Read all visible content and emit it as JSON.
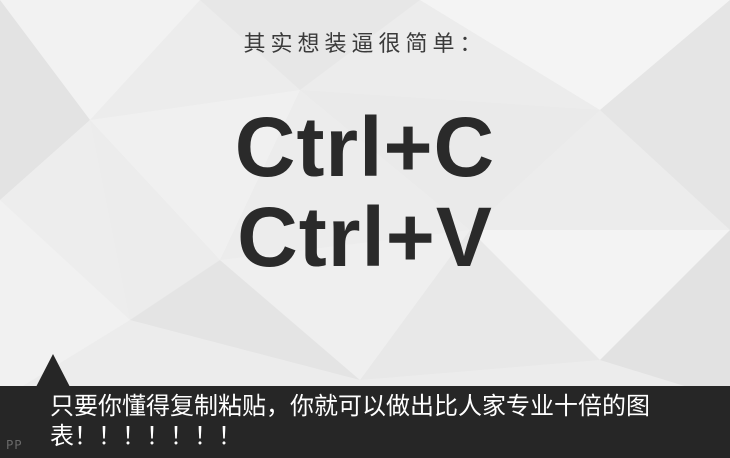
{
  "slide": {
    "subtitle": "其实想装逼很简单：",
    "shortcut_copy": "Ctrl+C",
    "shortcut_paste": "Ctrl+V",
    "caption": "只要你懂得复制粘贴，你就可以做出比人家专业十倍的图表！！！！！！！",
    "watermark": "PP"
  },
  "colors": {
    "background": "#ececec",
    "text_dark": "#2a2a2a",
    "caption_bar": "#262626",
    "caption_text": "#ffffff"
  }
}
